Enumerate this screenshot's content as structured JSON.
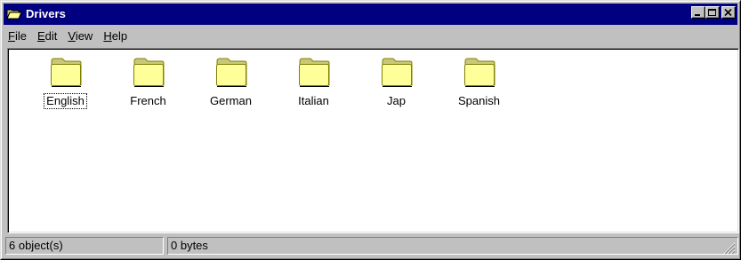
{
  "window": {
    "title": "Drivers",
    "icon": "folder-open-icon",
    "buttons": [
      "minimize-icon",
      "maximize-icon",
      "close-icon"
    ]
  },
  "menubar": {
    "items": [
      {
        "label": "File",
        "accel": "F"
      },
      {
        "label": "Edit",
        "accel": "E"
      },
      {
        "label": "View",
        "accel": "V"
      },
      {
        "label": "Help",
        "accel": "H"
      }
    ]
  },
  "folders": [
    {
      "label": "English",
      "focused": true
    },
    {
      "label": "French",
      "focused": false
    },
    {
      "label": "German",
      "focused": false
    },
    {
      "label": "Italian",
      "focused": false
    },
    {
      "label": "Jap",
      "focused": false
    },
    {
      "label": "Spanish",
      "focused": false
    }
  ],
  "statusbar": {
    "objects": "6 object(s)",
    "size": "0 bytes"
  },
  "colors": {
    "titlebar": "#000080",
    "face": "#c0c0c0",
    "folder_fill": "#ffff99",
    "folder_shade": "#c8c878"
  }
}
